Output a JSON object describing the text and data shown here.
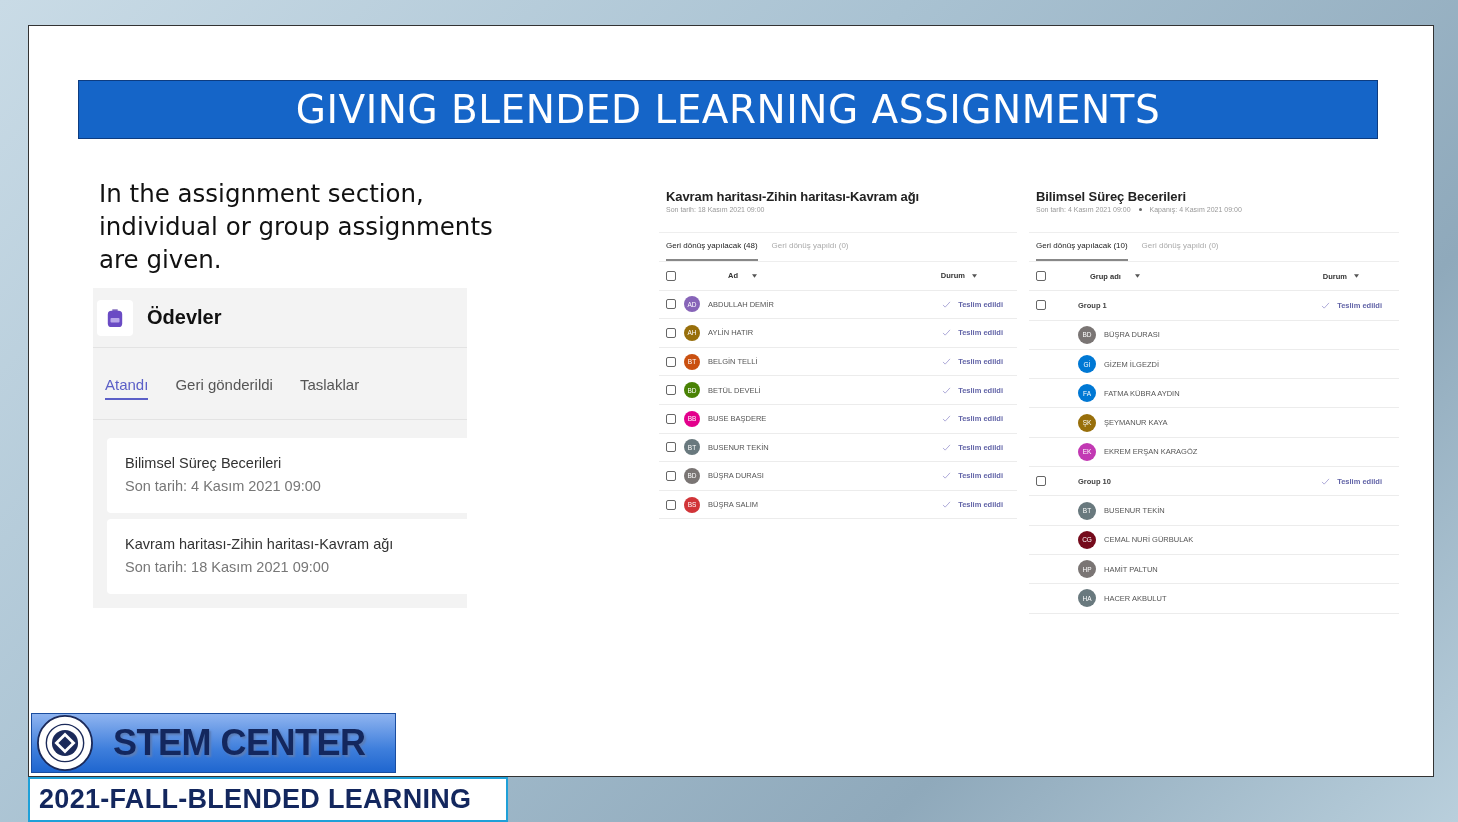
{
  "slide": {
    "title": "GIVING BLENDED LEARNING ASSIGNMENTS",
    "body_text": "In the assignment section, individual or group assignments are given.",
    "banner": "STEM CENTER",
    "subtitle": "2021-FALL-BLENDED LEARNING"
  },
  "assignments_panel": {
    "app_title": "Ödevler",
    "tabs": [
      {
        "label": "Atandı",
        "selected": true
      },
      {
        "label": "Geri gönderildi",
        "selected": false
      },
      {
        "label": "Taslaklar",
        "selected": false
      }
    ],
    "cards": [
      {
        "title": "Bilimsel Süreç Becerileri",
        "due": "Son tarih: 4 Kasım 2021 09:00"
      },
      {
        "title": "Kavram haritası-Zihin haritası-Kavram ağı",
        "due": "Son tarih: 18 Kasım 2021 09:00"
      }
    ]
  },
  "individual_view": {
    "title": "Kavram haritası-Zihin haritası-Kavram ağı",
    "meta": [
      "Son tarih: 18 Kasım 2021 09:00"
    ],
    "tabs": [
      {
        "label": "Geri dönüş yapılacak (48)",
        "selected": true
      },
      {
        "label": "Geri dönüş yapıldı (0)",
        "selected": false
      }
    ],
    "columns": [
      "Ad",
      "Durum"
    ],
    "select_all_checked": false,
    "rows": [
      {
        "kind": "student",
        "checked": false,
        "initials": "AD",
        "name": "ABDULLAH DEMİR",
        "color": "#8764b8",
        "status": "Teslim edildi"
      },
      {
        "kind": "student",
        "checked": false,
        "initials": "AH",
        "name": "AYLİN HATIR",
        "color": "#986f0b",
        "status": "Teslim edildi"
      },
      {
        "kind": "student",
        "checked": false,
        "initials": "BT",
        "name": "BELGİN TELLİ",
        "color": "#ca5010",
        "status": "Teslim edildi"
      },
      {
        "kind": "student",
        "checked": false,
        "initials": "BD",
        "name": "BETÜL DEVELİ",
        "color": "#498205",
        "status": "Teslim edildi"
      },
      {
        "kind": "student",
        "checked": false,
        "initials": "BB",
        "name": "BUSE BAŞDERE",
        "color": "#e3008c",
        "status": "Teslim edildi"
      },
      {
        "kind": "student",
        "checked": false,
        "initials": "BT",
        "name": "BUSENUR TEKİN",
        "color": "#69797e",
        "status": "Teslim edildi"
      },
      {
        "kind": "student",
        "checked": false,
        "initials": "BD",
        "name": "BÜŞRA DURASI",
        "color": "#7a7574",
        "status": "Teslim edildi"
      },
      {
        "kind": "student",
        "checked": false,
        "initials": "BS",
        "name": "BÜŞRA SALIM",
        "color": "#d13438",
        "status": "Teslim edildi"
      }
    ]
  },
  "group_view": {
    "title": "Bilimsel Süreç Becerileri",
    "meta": [
      "Son tarih: 4 Kasım 2021 09:00",
      "Kapanış: 4 Kasım 2021 09:00"
    ],
    "tabs": [
      {
        "label": "Geri dönüş yapılacak (10)",
        "selected": true
      },
      {
        "label": "Geri dönüş yapıldı (0)",
        "selected": false
      }
    ],
    "columns": [
      "Grup adı",
      "Durum"
    ],
    "select_all_checked": false,
    "rows": [
      {
        "kind": "group",
        "checked": false,
        "name": "Group 1",
        "status": "Teslim edildi"
      },
      {
        "kind": "member",
        "initials": "BD",
        "name": "BÜŞRA DURASI",
        "color": "#7a7574"
      },
      {
        "kind": "member",
        "initials": "Gİ",
        "name": "GİZEM İLGEZDİ",
        "color": "#0078d4"
      },
      {
        "kind": "member",
        "initials": "FA",
        "name": "FATMA KÜBRA AYDIN",
        "color": "#0078d4"
      },
      {
        "kind": "member",
        "initials": "ŞK",
        "name": "ŞEYMANUR KAYA",
        "color": "#986f0b"
      },
      {
        "kind": "member",
        "initials": "EK",
        "name": "EKREM ERŞAN KARAGÖZ",
        "color": "#c239b3"
      },
      {
        "kind": "group",
        "checked": false,
        "name": "Group 10",
        "status": "Teslim edildi"
      },
      {
        "kind": "member",
        "initials": "BT",
        "name": "BUSENUR TEKİN",
        "color": "#69797e"
      },
      {
        "kind": "member",
        "initials": "CG",
        "name": "CEMAL NURİ GÜRBULAK",
        "color": "#750b1c"
      },
      {
        "kind": "member",
        "initials": "HP",
        "name": "HAMİT PALTUN",
        "color": "#7a7574"
      },
      {
        "kind": "member",
        "initials": "HA",
        "name": "HACER AKBULUT",
        "color": "#69797e"
      }
    ]
  }
}
